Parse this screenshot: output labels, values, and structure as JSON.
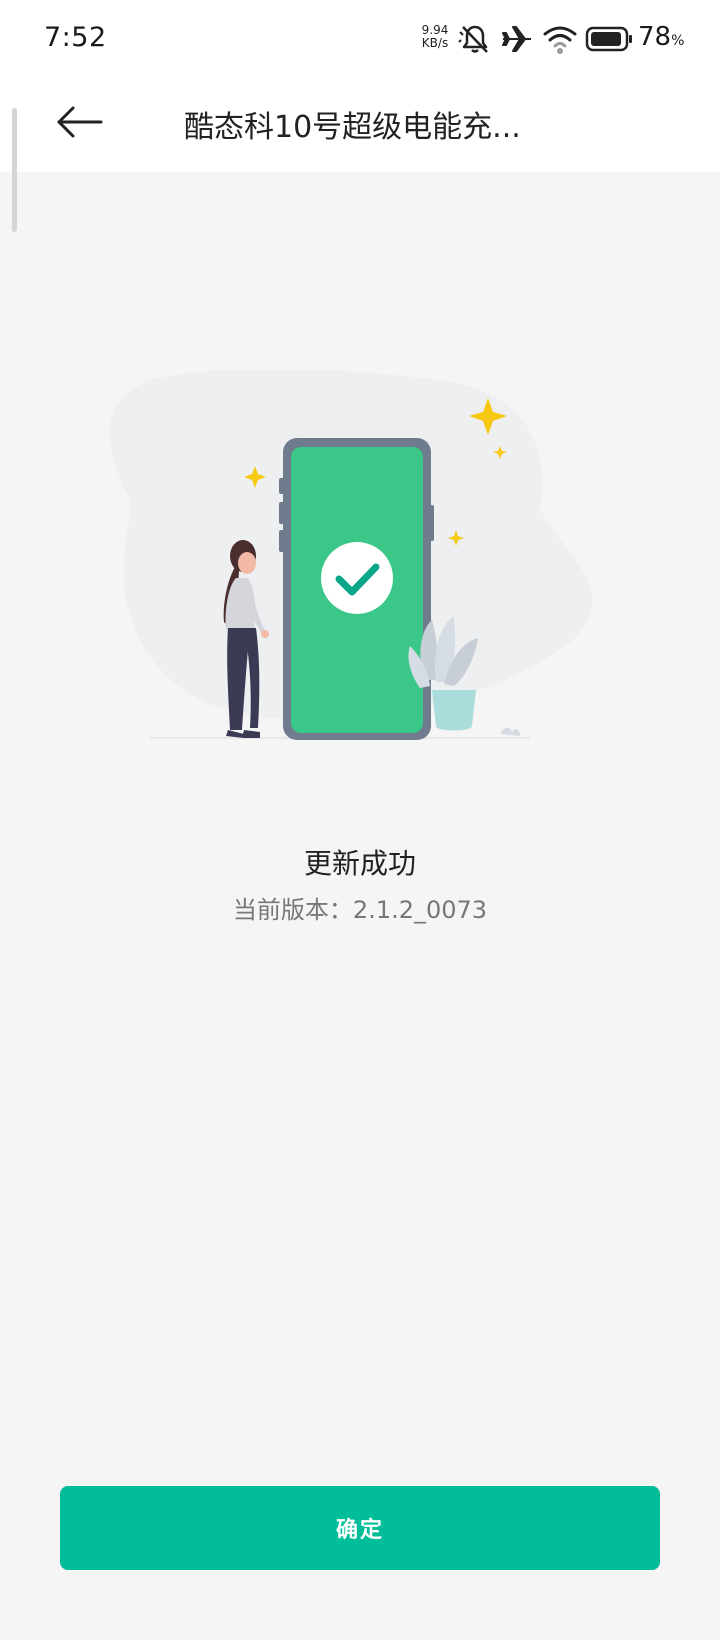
{
  "status_bar": {
    "time": "7:52",
    "net_speed_value": "9.94",
    "net_speed_unit": "KB/s",
    "battery_percent": "78",
    "battery_unit": "%",
    "icons": [
      "mute-icon",
      "airplane-icon",
      "wifi-icon",
      "battery-icon"
    ]
  },
  "header": {
    "title": "酷态科10号超级电能充...",
    "back_icon": "back-arrow-icon"
  },
  "result": {
    "title": "更新成功",
    "version": "当前版本：2.1.2_0073"
  },
  "footer": {
    "confirm_label": "确定"
  },
  "colors": {
    "accent": "#01bd9a",
    "phone_screen": "#3ac788",
    "sparkle": "#f6c915"
  }
}
